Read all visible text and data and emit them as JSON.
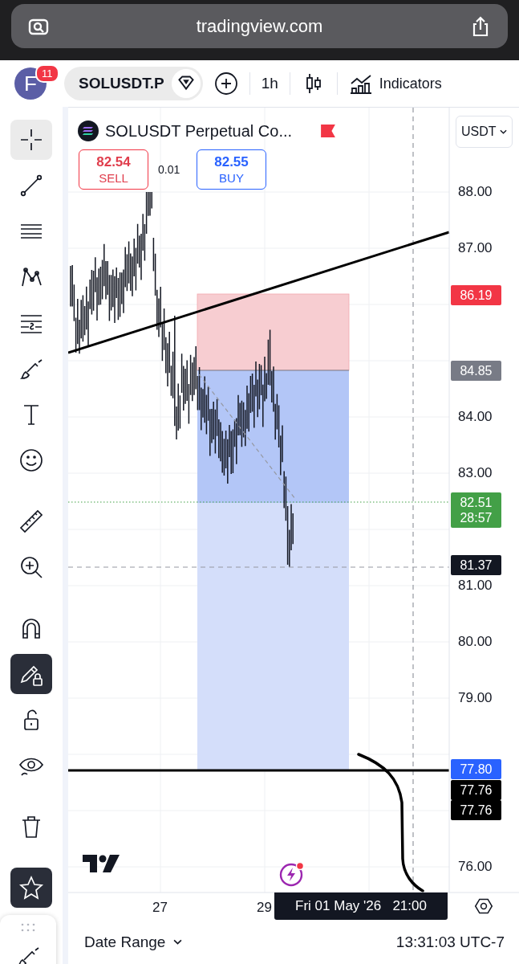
{
  "browser": {
    "url": "tradingview.com"
  },
  "toolbar": {
    "avatar_letter": "F",
    "notifications": "11",
    "symbol": "SOLUSDT.P",
    "interval": "1h",
    "indicators": "Indicators"
  },
  "tools": [
    {
      "kind": "crosshair",
      "selected": true
    },
    {
      "kind": "line",
      "selected": false
    },
    {
      "kind": "fib",
      "selected": false
    },
    {
      "kind": "pattern",
      "selected": false
    },
    {
      "kind": "sliders",
      "selected": false
    },
    {
      "kind": "brush",
      "selected": false
    },
    {
      "kind": "text",
      "selected": false
    },
    {
      "kind": "smiley",
      "selected": false
    },
    {
      "kind": "ruler",
      "selected": false
    },
    {
      "kind": "zoom",
      "selected": false
    },
    {
      "kind": "magnet",
      "selected": false
    },
    {
      "kind": "pencil-lock",
      "selected": true
    },
    {
      "kind": "unlock",
      "selected": false
    },
    {
      "kind": "eye",
      "selected": false
    },
    {
      "kind": "trash",
      "selected": false
    },
    {
      "kind": "star",
      "selected": true
    }
  ],
  "chart": {
    "title": "SOLUSDT Perpetual Co...",
    "currency": "USDT",
    "sell": {
      "price": "82.54",
      "label": "SELL"
    },
    "spread": "0.01",
    "buy": {
      "price": "82.55",
      "label": "BUY"
    },
    "price_ticks": [
      "88.00",
      "87.00",
      "84.00",
      "83.00",
      "81.00",
      "80.00",
      "79.00",
      "76.00"
    ],
    "price_badges": [
      {
        "text": "86.19",
        "color": "#f23645"
      },
      {
        "text": "84.85",
        "color": "#787b86"
      },
      {
        "text": "82.51",
        "sub": "28:57",
        "color": "#43a047"
      },
      {
        "text": "81.37",
        "color": "#131722"
      },
      {
        "text": "77.80",
        "color": "#2962ff"
      },
      {
        "text": "77.76",
        "color": "#000000"
      },
      {
        "text": "77.76",
        "color": "#000000"
      }
    ],
    "time_labels": [
      "27",
      "29"
    ],
    "crosshair_time": "Fri 01 May '26   21:00"
  },
  "bottom_bar": {
    "date_range": "Date Range",
    "clock": "13:31:03 UTC-7"
  }
}
